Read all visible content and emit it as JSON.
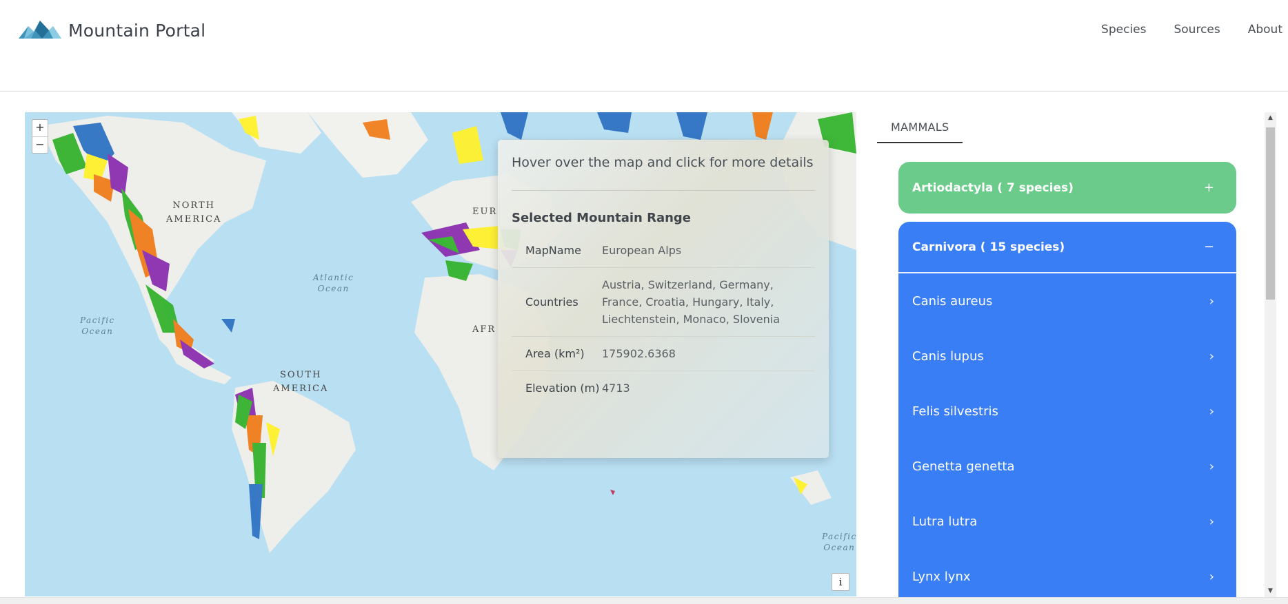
{
  "header": {
    "title": "Mountain Portal",
    "nav": [
      "Species",
      "Sources",
      "About"
    ]
  },
  "map": {
    "zoom_in": "+",
    "zoom_out": "−",
    "info": "i",
    "labels": {
      "north_america": "NORTH\nAMERICA",
      "south_america": "SOUTH\nAMERICA",
      "atlantic": "Atlantic\nOcean",
      "pacific_w": "Pacific\nOcean",
      "pacific_e": "Pacific\nOcean",
      "europe": "EUR",
      "africa": "AFR"
    },
    "colors": {
      "ocean": "#b9dff2",
      "land": "#eeeeea",
      "green": "#35b32e",
      "orange": "#f07d1a",
      "purple": "#8b2fb0",
      "yellow": "#fff12b",
      "blue": "#2f73c4"
    }
  },
  "popup": {
    "hint": "Hover over the map and click for more details",
    "section_title": "Selected Mountain Range",
    "rows": [
      {
        "key": "MapName",
        "value": "European Alps"
      },
      {
        "key": "Countries",
        "value": "Austria, Switzerland, Germany, France, Croatia, Hungary, Italy, Liechtenstein, Monaco, Slovenia"
      },
      {
        "key": "Area (km²)",
        "value": "175902.6368"
      },
      {
        "key": "Elevation (m)",
        "value": "4713"
      }
    ]
  },
  "sidebar": {
    "tab": "MAMMALS",
    "groups": [
      {
        "label": "Artiodactyla ( 7 species)",
        "sign": "+",
        "color": "#6bcb8a"
      },
      {
        "label": "Carnivora ( 15 species)",
        "sign": "−",
        "color": "#3a7ef5"
      }
    ],
    "species": [
      "Canis aureus",
      "Canis lupus",
      "Felis silvestris",
      "Genetta genetta",
      "Lutra lutra",
      "Lynx lynx"
    ]
  }
}
